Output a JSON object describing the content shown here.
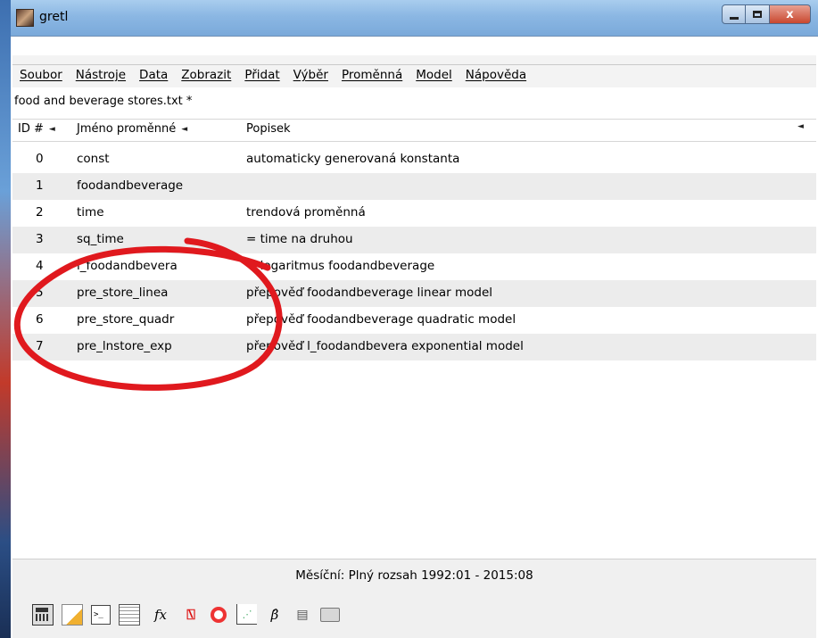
{
  "window": {
    "title": "gretl",
    "controls": {
      "minimize": "minimize",
      "maximize": "maximize",
      "close": "x"
    }
  },
  "menu": {
    "items": [
      "Soubor",
      "Nástroje",
      "Data",
      "Zobrazit",
      "Přidat",
      "Výběr",
      "Proměnná",
      "Model",
      "Nápověda"
    ]
  },
  "file": {
    "name": "food and beverage stores.txt *"
  },
  "columns": {
    "id": "ID #",
    "name": "Jméno proměnné",
    "desc": "Popisek",
    "sort_icon": "◄"
  },
  "rows": [
    {
      "id": "0",
      "name": "const",
      "desc": "automaticky generovaná konstanta"
    },
    {
      "id": "1",
      "name": "foodandbeverage",
      "desc": ""
    },
    {
      "id": "2",
      "name": "time",
      "desc": "trendová proměnná"
    },
    {
      "id": "3",
      "name": "sq_time",
      "desc": "= time na druhou"
    },
    {
      "id": "4",
      "name": "l_foodandbevera",
      "desc": "= logaritmus foodandbeverage"
    },
    {
      "id": "5",
      "name": "pre_store_linea",
      "desc": "přepověď foodandbeverage linear model"
    },
    {
      "id": "6",
      "name": "pre_store_quadr",
      "desc": "přepověď foodandbeverage quadratic model"
    },
    {
      "id": "7",
      "name": "pre_lnstore_exp",
      "desc": "přepověď l_foodandbevera exponential model"
    }
  ],
  "status": {
    "text": "Měsíční: Plný rozsah 1992:01 - 2015:08"
  },
  "toolbar": {
    "icons": [
      "calculator-icon",
      "script-edit-icon",
      "terminal-icon",
      "data-table-icon",
      "function-icon",
      "pdf-icon",
      "help-icon",
      "scatter-plot-icon",
      "beta-icon",
      "database-icon",
      "folder-icon"
    ],
    "fx_label": "fx",
    "beta_label": "β̂"
  },
  "annotation": {
    "color": "#e0191e",
    "shape": "hand-drawn-ellipse"
  }
}
